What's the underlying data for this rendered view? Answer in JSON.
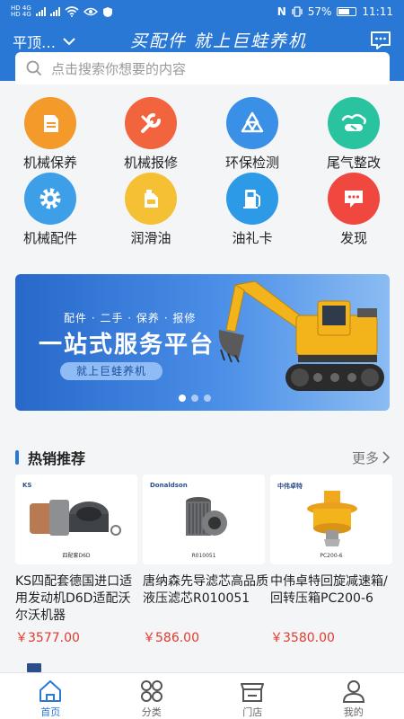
{
  "status_bar": {
    "sim_top": "HD 4G",
    "sim_bottom": "HD 4G",
    "nfc": "N",
    "battery": "57%",
    "time": "11:11"
  },
  "header": {
    "location": "平顶…",
    "slogan": "买配件 就上巨蛙养机"
  },
  "search": {
    "placeholder": "点击搜索你想要的内容"
  },
  "services": [
    {
      "label": "机械保养",
      "icon": "oil-can-icon",
      "color": "#f39a2b"
    },
    {
      "label": "机械报修",
      "icon": "wrench-icon",
      "color": "#f1643e"
    },
    {
      "label": "环保检测",
      "icon": "recycle-icon",
      "color": "#3a8fe6"
    },
    {
      "label": "尾气整改",
      "icon": "exhaust-icon",
      "color": "#29c3a0"
    },
    {
      "label": "机械配件",
      "icon": "gear-icon",
      "color": "#3c9fe8"
    },
    {
      "label": "润滑油",
      "icon": "lubricant-icon",
      "color": "#f5c033"
    },
    {
      "label": "油礼卡",
      "icon": "fuel-pump-icon",
      "color": "#2d9ae8"
    },
    {
      "label": "发现",
      "icon": "discover-icon",
      "color": "#f0473f"
    }
  ],
  "banner": {
    "subtitle": "配件 · 二手 · 保养 · 报修",
    "title": "一站式服务平台",
    "pill": "就上巨蛙养机"
  },
  "section": {
    "title": "热销推荐",
    "more": "更多"
  },
  "products": [
    {
      "name": "KS四配套德国进口适用发动机D6D适配沃尔沃机器",
      "price": "￥3577.00",
      "image_brand": "KS",
      "image_caption": "四配套D6D"
    },
    {
      "name": "唐纳森先导滤芯高品质液压滤芯R010051",
      "price": "￥586.00",
      "image_brand": "Donaldson",
      "image_caption": "R010051"
    },
    {
      "name": "中伟卓特回旋减速箱/回转压箱PC200-6",
      "price": "￥3580.00",
      "image_brand": "中伟卓特",
      "image_caption": "PC200-6"
    }
  ],
  "tabbar": [
    {
      "label": "首页",
      "icon": "home-icon",
      "active": true
    },
    {
      "label": "分类",
      "icon": "category-icon",
      "active": false
    },
    {
      "label": "门店",
      "icon": "store-icon",
      "active": false
    },
    {
      "label": "我的",
      "icon": "profile-icon",
      "active": false
    }
  ],
  "colors": {
    "primary": "#2a78d6",
    "price": "#e23a2e"
  }
}
